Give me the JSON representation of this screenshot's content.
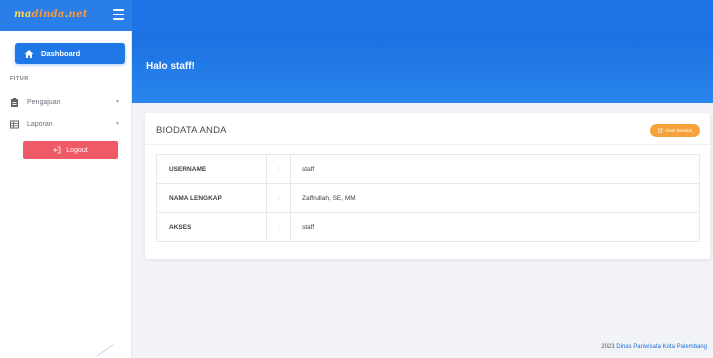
{
  "brand": {
    "part1": "ma",
    "part2": "dinda",
    "part3": "net"
  },
  "sidebar": {
    "dashboard_label": "Dashboard",
    "section_label": "FITUR",
    "items": [
      {
        "label": "Pengajuan",
        "icon": "clipboard-icon"
      },
      {
        "label": "Laporan",
        "icon": "table-icon"
      }
    ],
    "logout_label": "Logout"
  },
  "hero": {
    "title": "Halo staff!"
  },
  "card": {
    "title": "BIODATA ANDA",
    "edit_label": "Ubah Biodata",
    "rows": [
      {
        "key": "USERNAME",
        "sep": ":",
        "value": "staff"
      },
      {
        "key": "NAMA LENGKAP",
        "sep": ":",
        "value": "Zaffrullah, SE, MM"
      },
      {
        "key": "AKSES",
        "sep": ":",
        "value": "staff"
      }
    ]
  },
  "footer": {
    "year": "2023",
    "org": "Dinas Pariwisata Kota Palembang"
  },
  "colors": {
    "primary": "#1d74e7",
    "danger": "#ef5a67",
    "warning": "#f6a23c"
  }
}
